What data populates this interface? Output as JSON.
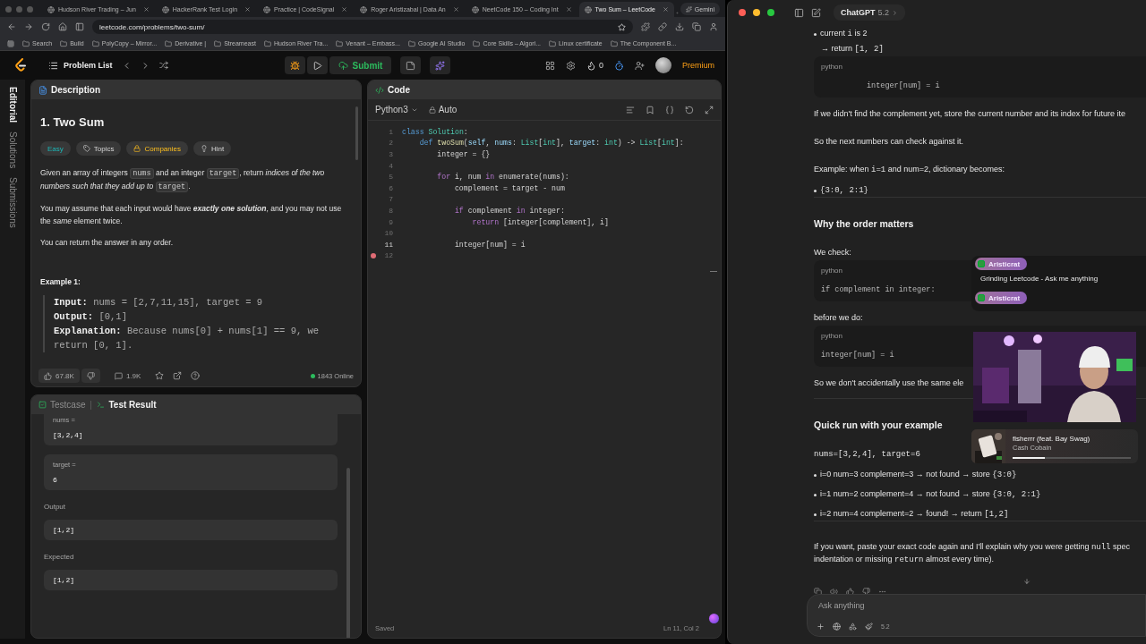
{
  "browser": {
    "tabs": [
      {
        "label": "Hudson River Trading – Jun",
        "selected": false
      },
      {
        "label": "HackerRank Test Login",
        "selected": false
      },
      {
        "label": "Practice | CodeSignal",
        "selected": false
      },
      {
        "label": "Roger Aristizabal | Data An",
        "selected": false
      },
      {
        "label": "NeetCode 150 – Coding Int",
        "selected": false
      },
      {
        "label": "Two Sum – LeetCode",
        "selected": true
      }
    ],
    "assistant_button": "Gemini",
    "url": "leetcode.com/problems/two-sum/",
    "bookmarks": [
      "Search",
      "Build",
      "PolyCopy – Mirror...",
      "Derivative |",
      "Streameast",
      "Hudson River Tra...",
      "Venant – Embass...",
      "Google AI Studio",
      "Core Skills – Algori...",
      "Linux certificate",
      "The Component B..."
    ]
  },
  "leetcode": {
    "nav": {
      "problem_list": "Problem List",
      "submit": "Submit",
      "streak": "0",
      "premium": "Premium"
    },
    "side_tabs": [
      {
        "label": "Editorial",
        "selected": true
      },
      {
        "label": "Solutions",
        "selected": false
      },
      {
        "label": "Submissions",
        "selected": false
      }
    ],
    "description": {
      "tab": "Description",
      "title": "1. Two Sum",
      "tags": [
        {
          "label": "Easy",
          "kind": "difficulty"
        },
        {
          "label": "Topics",
          "kind": "topics"
        },
        {
          "label": "Companies",
          "kind": "companies"
        },
        {
          "label": "Hint",
          "kind": "hint"
        }
      ],
      "paragraphs": [
        [
          {
            "kind": "text",
            "text": "Given an array of integers "
          },
          {
            "kind": "code",
            "text": "nums"
          },
          {
            "kind": "text",
            "text": " and an integer "
          },
          {
            "kind": "code",
            "text": "target"
          },
          {
            "kind": "text",
            "text": ", return "
          },
          {
            "kind": "italic",
            "text": "indices of the two numbers such that they add up to "
          },
          {
            "kind": "code",
            "text": "target"
          },
          {
            "kind": "text",
            "text": "."
          }
        ],
        [
          {
            "kind": "text",
            "text": "You may assume that each input would have "
          },
          {
            "kind": "bolditalic",
            "text": "exactly one solution"
          },
          {
            "kind": "text",
            "text": ", and you may not use the "
          },
          {
            "kind": "italic",
            "text": "same"
          },
          {
            "kind": "text",
            "text": " element twice."
          }
        ],
        [
          {
            "kind": "text",
            "text": "You can return the answer in any order."
          }
        ]
      ],
      "example_title": "Example 1:",
      "example": [
        {
          "label": "Input:",
          "value": "nums = [2,7,11,15], target = 9"
        },
        {
          "label": "Output:",
          "value": "[0,1]"
        },
        {
          "label": "Explanation:",
          "value": "Because nums[0] + nums[1] == 9, we return [0, 1]."
        }
      ],
      "footer": {
        "likes": "67.8K",
        "comments": "1.9K",
        "online": "1843 Online"
      }
    },
    "testcase": {
      "tabs": [
        {
          "label": "Testcase",
          "selected": false
        },
        {
          "label": "Test Result",
          "selected": true
        }
      ],
      "inputs": [
        {
          "label": "nums =",
          "value": "[3,2,4]"
        },
        {
          "label": "target =",
          "value": "6"
        }
      ],
      "results": [
        {
          "label": "Output",
          "value": "[1,2]"
        },
        {
          "label": "Expected",
          "value": "[1,2]"
        }
      ]
    },
    "code": {
      "tab": "Code",
      "language": "Python3",
      "mode": "Auto",
      "status": "Saved",
      "cursor": "Ln 11, Col 2",
      "lines": [
        {
          "number": "1",
          "current": false,
          "breakpoint": false,
          "tokens": [
            {
              "kind": "kw",
              "text": "class"
            },
            {
              "kind": "cls",
              "text": " Solution"
            },
            {
              "kind": "plain",
              "text": ":"
            }
          ]
        },
        {
          "number": "2",
          "current": false,
          "breakpoint": false,
          "tokens": [
            {
              "kind": "kw",
              "text": "    def"
            },
            {
              "kind": "fn",
              "text": " twoSum"
            },
            {
              "kind": "plain",
              "text": "("
            },
            {
              "kind": "var",
              "text": "self"
            },
            {
              "kind": "plain",
              "text": ", "
            },
            {
              "kind": "var",
              "text": "nums"
            },
            {
              "kind": "plain",
              "text": ": "
            },
            {
              "kind": "cls",
              "text": "List"
            },
            {
              "kind": "plain",
              "text": "["
            },
            {
              "kind": "cls",
              "text": "int"
            },
            {
              "kind": "plain",
              "text": "], "
            },
            {
              "kind": "var",
              "text": "target"
            },
            {
              "kind": "plain",
              "text": ": "
            },
            {
              "kind": "cls",
              "text": "int"
            },
            {
              "kind": "plain",
              "text": ") -> "
            },
            {
              "kind": "cls",
              "text": "List"
            },
            {
              "kind": "plain",
              "text": "["
            },
            {
              "kind": "cls",
              "text": "int"
            },
            {
              "kind": "plain",
              "text": "]:"
            }
          ]
        },
        {
          "number": "3",
          "current": false,
          "breakpoint": false,
          "tokens": [
            {
              "kind": "plain",
              "text": "        integer = {}"
            }
          ]
        },
        {
          "number": "4",
          "current": false,
          "breakpoint": false
        },
        {
          "number": "5",
          "current": false,
          "breakpoint": false,
          "tokens": [
            {
              "kind": "flow",
              "text": "        for"
            },
            {
              "kind": "plain",
              "text": " i, num "
            },
            {
              "kind": "flow",
              "text": "in"
            },
            {
              "kind": "plain",
              "text": " enumerate(nums):"
            }
          ]
        },
        {
          "number": "6",
          "current": false,
          "breakpoint": false,
          "tokens": [
            {
              "kind": "plain",
              "text": "            complement = target - num"
            }
          ]
        },
        {
          "number": "7",
          "current": false,
          "breakpoint": false
        },
        {
          "number": "8",
          "current": false,
          "breakpoint": false,
          "tokens": [
            {
              "kind": "flow",
              "text": "            if"
            },
            {
              "kind": "plain",
              "text": " complement "
            },
            {
              "kind": "flow",
              "text": "in"
            },
            {
              "kind": "plain",
              "text": " integer:"
            }
          ]
        },
        {
          "number": "9",
          "current": false,
          "breakpoint": false,
          "tokens": [
            {
              "kind": "flow",
              "text": "                return"
            },
            {
              "kind": "plain",
              "text": " [integer[complement], i]"
            }
          ]
        },
        {
          "number": "10",
          "current": false,
          "breakpoint": false
        },
        {
          "number": "11",
          "current": true,
          "breakpoint": false,
          "tokens": [
            {
              "kind": "plain",
              "text": "            integer[num] = i"
            }
          ]
        },
        {
          "number": "12",
          "current": false,
          "breakpoint": true
        }
      ]
    }
  },
  "chat": {
    "model": {
      "name": "ChatGPT",
      "version": "5.2"
    },
    "blocks": [
      {
        "kind": "bullet",
        "segs": [
          {
            "kind": "text",
            "text": "current "
          },
          {
            "kind": "code",
            "text": "i"
          },
          {
            "kind": "text",
            "text": " is 2"
          }
        ]
      },
      {
        "kind": "line",
        "segs": [
          {
            "kind": "text",
            "text": "→ return "
          },
          {
            "kind": "code",
            "text": "[1, 2]"
          }
        ]
      },
      {
        "kind": "code",
        "lang": "python",
        "code": "          integer[num] = i"
      },
      {
        "kind": "para",
        "segs": [
          {
            "kind": "text",
            "text": "If we didn't find the complement yet, store the current number and its index for future ite"
          }
        ]
      },
      {
        "kind": "para",
        "segs": [
          {
            "kind": "text",
            "text": "So the next numbers can check against it."
          }
        ]
      },
      {
        "kind": "para",
        "segs": [
          {
            "kind": "text",
            "text": "Example: when "
          },
          {
            "kind": "code",
            "text": "i=1"
          },
          {
            "kind": "text",
            "text": " and num=2, dictionary becomes:"
          }
        ]
      },
      {
        "kind": "bullet",
        "segs": [
          {
            "kind": "code",
            "text": "{3:0, 2:1}"
          }
        ]
      },
      {
        "kind": "rule"
      },
      {
        "kind": "heading",
        "segs": [
          {
            "kind": "text",
            "text": "Why the order matters"
          }
        ]
      },
      {
        "kind": "para",
        "segs": [
          {
            "kind": "text",
            "text": "We check:"
          }
        ]
      },
      {
        "kind": "code",
        "lang": "python",
        "code": "if complement in integer:"
      },
      {
        "kind": "para",
        "segs": [
          {
            "kind": "text",
            "text": "before we do:"
          }
        ]
      },
      {
        "kind": "code",
        "lang": "python",
        "code": "integer[num] = i"
      },
      {
        "kind": "para",
        "segs": [
          {
            "kind": "text",
            "text": "So we don't accidentally use the same ele"
          }
        ]
      },
      {
        "kind": "rule"
      },
      {
        "kind": "heading",
        "segs": [
          {
            "kind": "text",
            "text": "Quick run with your example"
          }
        ]
      },
      {
        "kind": "para",
        "segs": [
          {
            "kind": "code",
            "text": "nums=[3,2,4], target=6"
          }
        ]
      },
      {
        "kind": "bullet",
        "segs": [
          {
            "kind": "text",
            "text": "i=0 num=3 complement=3 → not found → store "
          },
          {
            "kind": "code",
            "text": "{3:0}"
          }
        ]
      },
      {
        "kind": "bullet",
        "segs": [
          {
            "kind": "text",
            "text": "i=1 num=2 complement=4 → not found → store "
          },
          {
            "kind": "code",
            "text": "{3:0, 2:1}"
          }
        ]
      },
      {
        "kind": "bullet",
        "segs": [
          {
            "kind": "text",
            "text": "i=2 num=4 complement=2 → found! → return "
          },
          {
            "kind": "code",
            "text": "[1,2]"
          }
        ]
      },
      {
        "kind": "rule"
      },
      {
        "kind": "para",
        "segs": [
          {
            "kind": "text",
            "text": "If you want, paste your exact code again and I'll explain why you were getting "
          },
          {
            "kind": "code",
            "text": "null"
          },
          {
            "kind": "text",
            "text": " spec"
          },
          {
            "kind": "break"
          },
          {
            "kind": "text",
            "text": "indentation or missing "
          },
          {
            "kind": "code",
            "text": "return"
          },
          {
            "kind": "text",
            "text": " almost every time)."
          }
        ]
      }
    ],
    "composer": {
      "placeholder": "Ask anything",
      "model_badge": "5.2"
    },
    "stream_chat": [
      {
        "user": "Aristicrat",
        "message": "Grinding Leetcode - Ask me anything"
      },
      {
        "user": "Aristicrat"
      }
    ],
    "music_player": {
      "title": "fisherrr (feat. Bay Swag)",
      "artist": "Cash Cobain",
      "level": 0.27
    }
  }
}
